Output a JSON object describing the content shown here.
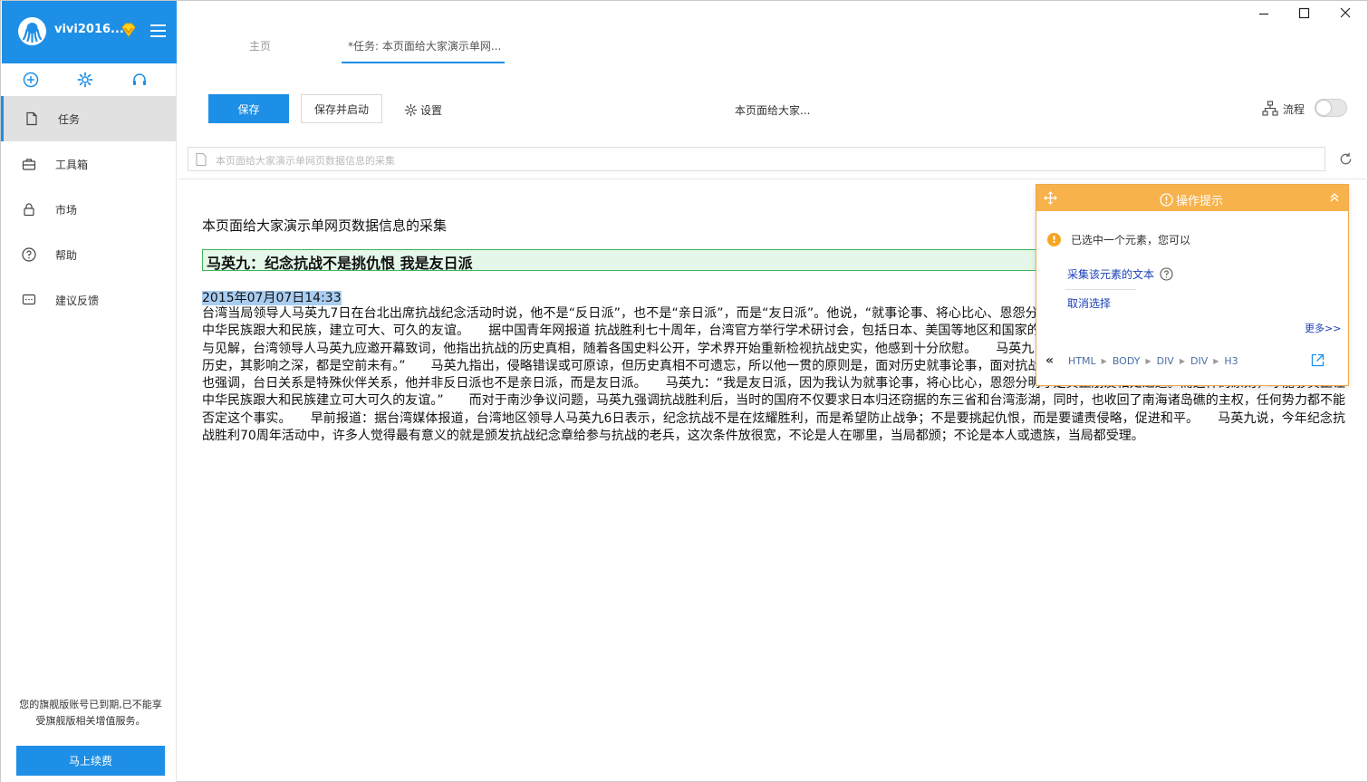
{
  "user": {
    "name": "vivi2016..."
  },
  "sidebar": {
    "items": [
      {
        "label": "任务",
        "icon": "file-icon"
      },
      {
        "label": "工具箱",
        "icon": "toolbox-icon"
      },
      {
        "label": "市场",
        "icon": "lock-icon"
      },
      {
        "label": "帮助",
        "icon": "help-circle-icon"
      },
      {
        "label": "建议反馈",
        "icon": "feedback-icon"
      }
    ],
    "expire_note": "您的旗舰版账号已到期,已不能享受旗舰版相关增值服务。",
    "renew_label": "马上续费"
  },
  "tabs": [
    {
      "label": "主页"
    },
    {
      "label": "*任务: 本页面给大家演示单网..."
    }
  ],
  "toolbar": {
    "save_label": "保存",
    "save_start_label": "保存并启动",
    "settings_label": "设置",
    "task_name": "本页面给大家...",
    "flow_label": "流程"
  },
  "urlbar": {
    "text": "本页面给大家演示单网页数据信息的采集"
  },
  "content": {
    "heading": "本页面给大家演示单网页数据信息的采集",
    "title": "马英九：纪念抗战不是挑仇恨 我是友日派",
    "date": "2015年07月07日14:33",
    "body": "台湾当局领导人马英九7日在台北出席抗战纪念活动时说，他不是“反日派”，也不是“亲日派”，而是“友日派”。他说，“就事论事、将心比心、恩怨分明才是真正朋友相处之道。而这样的原则，才能真正让中华民族跟大和民族，建立可大、可久的友谊。　　据中国青年网报道 抗战胜利七十周年，台湾官方举行学术研讨会，包括日本、美国等地区和国家的学者共两百多人齐聚一堂，交流分享对抗战历史的研究与见解，台湾领导人马英九应邀开幕致词，他指出抗战的历史真相，随着各国史料公开，学术界开始重新检视抗战史实，他感到十分欣慰。　　马英九：“八年抗战使影响国家存亡，深刻影响国际情势的重大历史，其影响之深，都是空前未有。”　　马英九指出，侵略错误或可原谅，但历史真相不可遗忘，所以他一贯的原则是，面对历史就事论事，面对抗战受难家属将心比心，对与蛀非要恩怨分明，不过马英九也强调，台日关系是特殊伙伴关系，他并非反日派也不是亲日派，而是友日派。　　马英九：“我是友日派，因为我认为就事论事，将心比心，恩怨分明才是真正朋友相处之道。而这样的原则，才能够真正让中华民族跟大和民族建立可大可久的友谊。”　　而对于南沙争议问题，马英九强调抗战胜利后，当时的国府不仅要求日本归还窃据的东三省和台湾澎湖，同时，也收回了南海诸岛礁的主权，任何势力都不能否定这个事实。　　早前报道：据台湾媒体报道，台湾地区领导人马英九6日表示，纪念抗战不是在炫耀胜利，而是希望防止战争；不是要挑起仇恨，而是要谴责侵略，促进和平。　　马英九说，今年纪念抗战胜利70周年活动中，许多人觉得最有意义的就是颁发抗战纪念章给参与抗战的老兵，这次条件放很宽，不论是人在哪里，当局都颁；不论是本人或遗族，当局都受理。"
  },
  "tip_panel": {
    "title": "操作提示",
    "message": "已选中一个元素，您可以",
    "action_collect": "采集该元素的文本",
    "action_cancel": "取消选择",
    "more": "更多>>",
    "crumbs": [
      "HTML",
      "BODY",
      "DIV",
      "DIV",
      "H3"
    ]
  },
  "colors": {
    "accent": "#1e8fe6",
    "tip_header": "#f7b24c",
    "selection_green": "#42b45a",
    "link": "#1a3fb5"
  }
}
